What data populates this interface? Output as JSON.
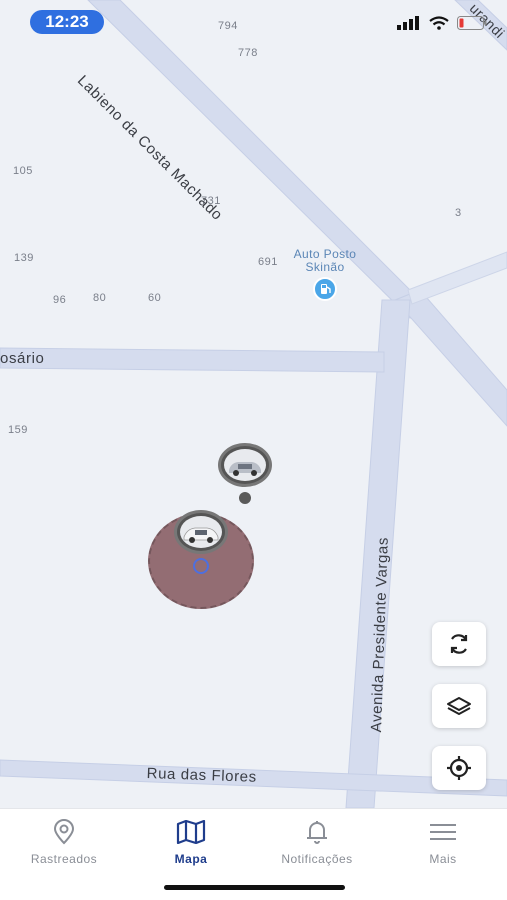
{
  "status_bar": {
    "time": "12:23"
  },
  "map": {
    "street_numbers": [
      "794",
      "778",
      "105",
      "731",
      "3",
      "139",
      "691",
      "96",
      "80",
      "60",
      "159"
    ],
    "roads": {
      "diagonal": "Labieno da Costa Machado",
      "rosario": "osário",
      "presidente_vargas": "Avenida Presidente Vargas",
      "flores": "Rua das Flores",
      "top_right": "urandi"
    },
    "poi": {
      "line1": "Auto Posto",
      "line2": "Skinão",
      "icon": "fuel-pin-icon"
    },
    "buttons": {
      "refresh": "refresh-icon",
      "layers": "layers-icon",
      "locate": "locate-icon"
    }
  },
  "tabbar": {
    "items": [
      {
        "label": "Rastreados",
        "icon": "map-pin-icon",
        "active": false
      },
      {
        "label": "Mapa",
        "icon": "map-icon",
        "active": true
      },
      {
        "label": "Notificações",
        "icon": "bell-icon",
        "active": false
      },
      {
        "label": "Mais",
        "icon": "menu-icon",
        "active": false
      }
    ]
  },
  "colors": {
    "accent": "#1f3d8c",
    "time_pill": "#2f6fe0",
    "road": "#d5dcee",
    "range_circle": "#8c6268"
  }
}
